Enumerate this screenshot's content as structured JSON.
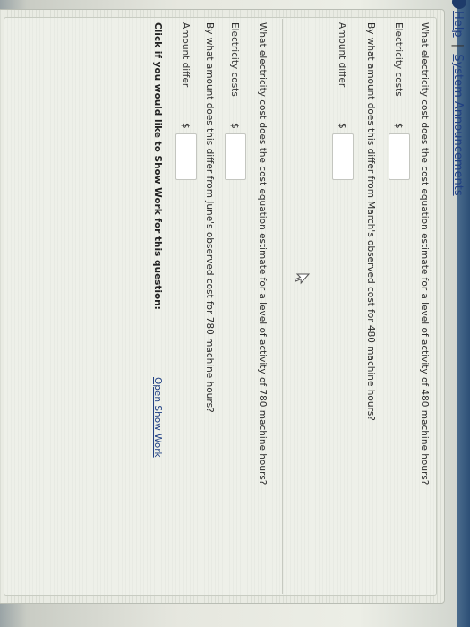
{
  "header": {
    "help_label": "Help",
    "separator": "|",
    "announcements_label": "System Announcements"
  },
  "part1": {
    "question": "What electricity cost does the cost equation estimate for a level of activity of 480 machine hours?",
    "costs_label": "Electricity costs",
    "costs_currency": "$",
    "costs_value": "",
    "differ_question": "By what amount does this differ from March's observed cost for 480 machine hours?",
    "differ_label": "Amount differ",
    "differ_currency": "$",
    "differ_value": ""
  },
  "part2": {
    "question": "What electricity cost does the cost equation estimate for a level of activity of 780 machine hours?",
    "costs_label": "Electricity costs",
    "costs_currency": "$",
    "costs_value": "",
    "differ_question": "By what amount does this differ from June's observed cost for 780 machine hours?",
    "differ_label": "Amount differ",
    "differ_currency": "$",
    "differ_value": ""
  },
  "footer": {
    "prompt": "Click if you would like to Show Work for this question:",
    "link_label": "Open Show Work"
  }
}
